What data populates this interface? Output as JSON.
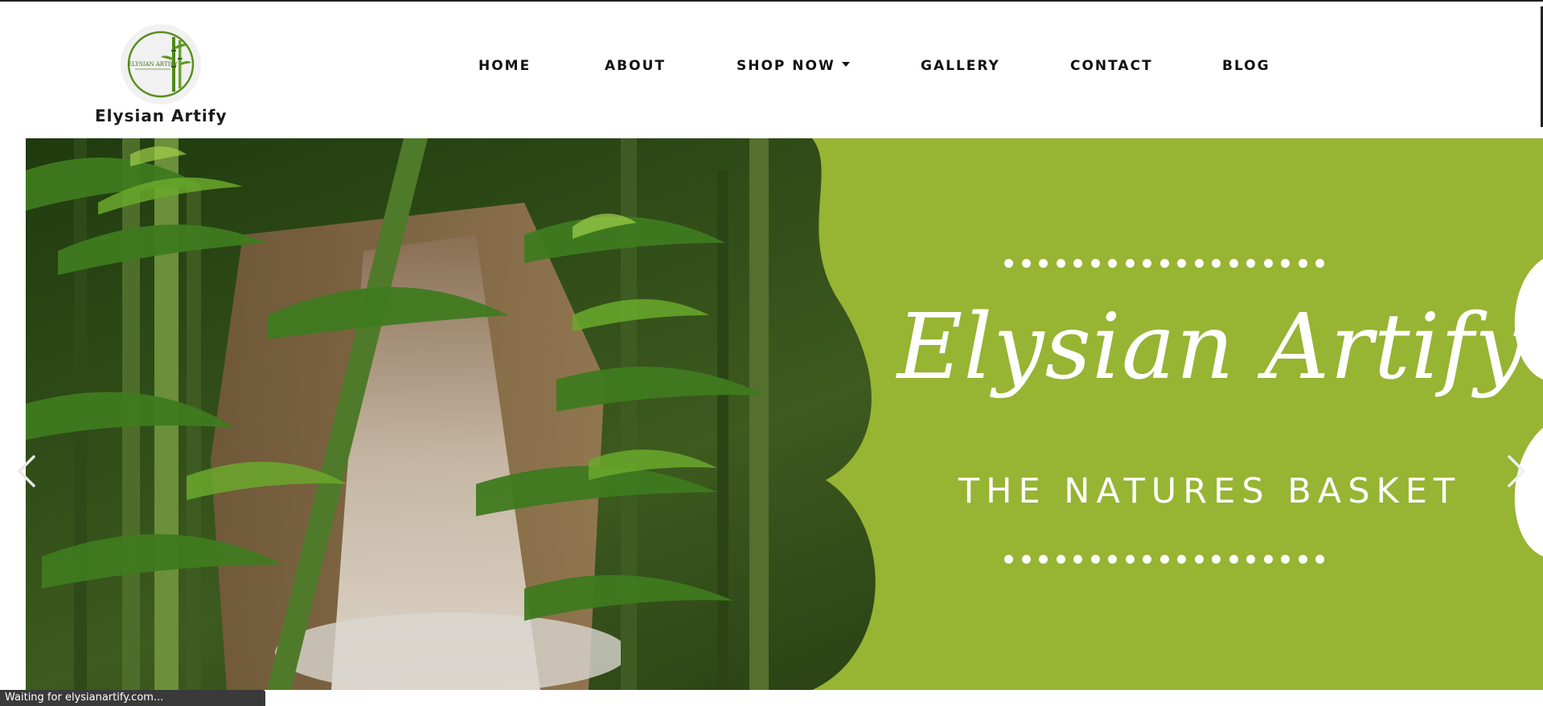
{
  "header": {
    "brand_name": "Elysian Artify",
    "logo_text": "ELYSIAN ARTIFY"
  },
  "nav": {
    "items": [
      {
        "label": "HOME"
      },
      {
        "label": "ABOUT"
      },
      {
        "label": "SHOP NOW"
      },
      {
        "label": "GALLERY"
      },
      {
        "label": "CONTACT"
      },
      {
        "label": "BLOG"
      }
    ]
  },
  "hero": {
    "title": "Elysian Artify",
    "subtitle": "THE NATURES BASKET",
    "prev_icon": "chevron-left-icon",
    "next_icon": "chevron-right-icon",
    "panel_color": "#97b433",
    "text_color": "#ffffff"
  },
  "status_bar": {
    "text": "Waiting for elysianartify.com..."
  }
}
